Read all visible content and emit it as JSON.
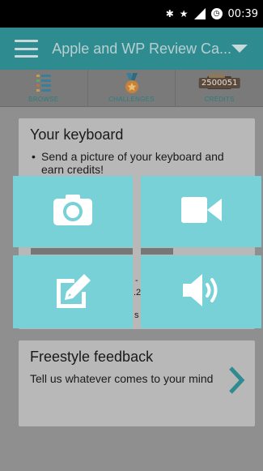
{
  "status_bar": {
    "bluetooth_icon": "bluetooth-icon",
    "star_icon": "star-icon",
    "signal_icon": "signal-icon",
    "signal_label": "H",
    "alarm_icon": "alarm-icon",
    "time": "00:39"
  },
  "app_bar": {
    "title": "Apple and WP Review Ca...",
    "menu_icon": "hamburger-menu-icon",
    "dropdown_icon": "caret-down-icon"
  },
  "tabs": [
    {
      "label": "BROWSE",
      "icon": "list-icon"
    },
    {
      "label": "CHALLENGES",
      "icon": "medal-icon"
    },
    {
      "label": "CREDITS",
      "icon": "wallet-icon",
      "badge": "2500051"
    }
  ],
  "keyboard_card": {
    "title": "Your keyboard",
    "bullet": "Send a picture of your keyboard and earn credits!",
    "partial_texts": [
      "-",
      ".2",
      "s"
    ]
  },
  "freestyle_card": {
    "title": "Freestyle feedback",
    "description": "Tell us whatever comes to your mind"
  },
  "media_options": [
    {
      "icon": "camera-icon"
    },
    {
      "icon": "video-camera-icon"
    },
    {
      "icon": "edit-icon"
    },
    {
      "icon": "speaker-icon"
    }
  ],
  "colors": {
    "app_bar": "#2e8c91",
    "tile": "#77d1d6",
    "dim_background": "#8f8f8f"
  }
}
